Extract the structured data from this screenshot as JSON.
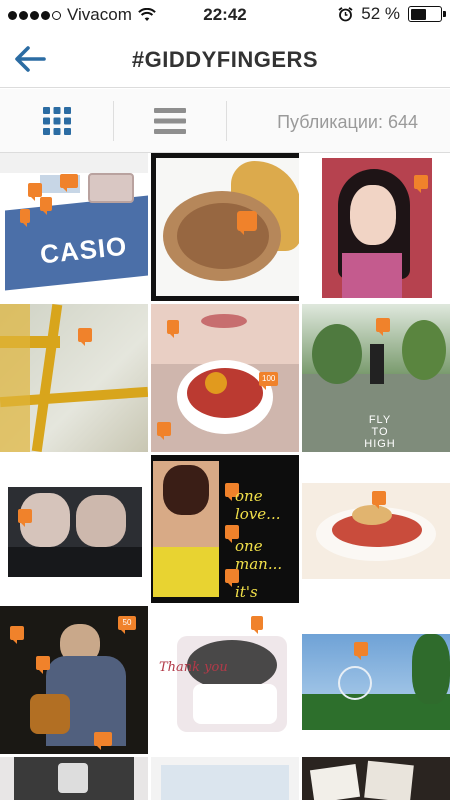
{
  "status_bar": {
    "carrier": "Vivacom",
    "time": "22:42",
    "battery_percent_label": "52 %",
    "battery_level": 0.52,
    "signal_bars_filled": 4,
    "signal_bars_total": 5
  },
  "nav": {
    "title": "#GIDDYFINGERS",
    "back_icon": "arrow-left-icon",
    "accent_color": "#2b6ca3"
  },
  "toolbar": {
    "grid_icon": "grid-view-icon",
    "list_icon": "list-view-icon",
    "posts_label": "Публикации: 644"
  },
  "posts": [
    {
      "name": "post-casio-watch",
      "logo_text": "CASIO"
    },
    {
      "name": "post-rice-dish"
    },
    {
      "name": "post-girl-portrait"
    },
    {
      "name": "post-yellow-window"
    },
    {
      "name": "post-fruit-bowl",
      "badge": "100"
    },
    {
      "name": "post-fly-to-high",
      "caption": "FLY TO HIGH"
    },
    {
      "name": "post-legs"
    },
    {
      "name": "post-one-love",
      "caption_lines": [
        "one love...",
        "one man...",
        "it's better..."
      ]
    },
    {
      "name": "post-dessert"
    },
    {
      "name": "post-bar-man",
      "badge": "50"
    },
    {
      "name": "post-thank-you-cake",
      "caption": "Thank you"
    },
    {
      "name": "post-ferris-wheel"
    },
    {
      "name": "post-tiger-room"
    },
    {
      "name": "post-partial-2"
    },
    {
      "name": "post-cards"
    }
  ]
}
